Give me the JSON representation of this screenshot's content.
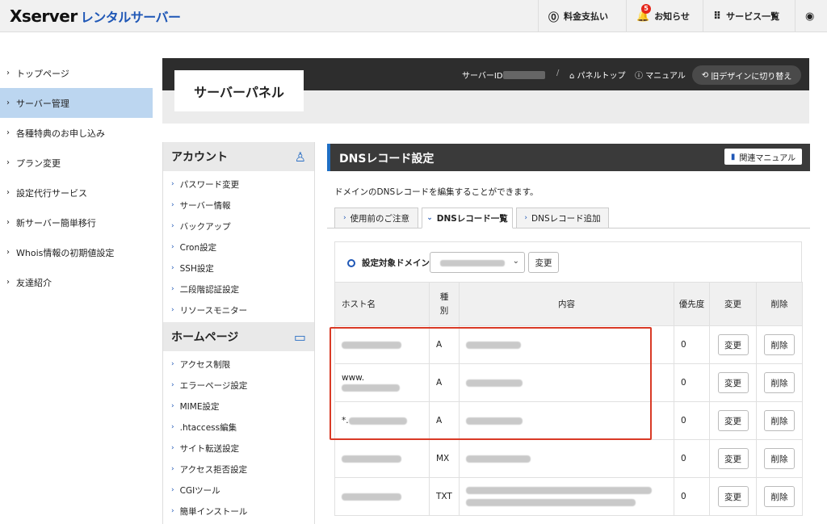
{
  "header": {
    "logo_brand": "Xserver",
    "logo_sub": "レンタルサーバー",
    "billing": "料金支払い",
    "notices": "お知らせ",
    "notice_count": "5",
    "services": "サービス一覧"
  },
  "nav": {
    "items": [
      {
        "label": "トップページ"
      },
      {
        "label": "サーバー管理"
      },
      {
        "label": "各種特典のお申し込み"
      },
      {
        "label": "プラン変更"
      },
      {
        "label": "設定代行サービス"
      },
      {
        "label": "新サーバー簡単移行"
      },
      {
        "label": "Whois情報の初期値設定"
      },
      {
        "label": "友達紹介"
      }
    ]
  },
  "panel": {
    "title": "サーバーパネル",
    "server_id_label": "サーバーID",
    "separator": "/",
    "panel_top": "パネルトップ",
    "manual": "マニュアル",
    "old_design": "旧デザインに切り替え"
  },
  "submenu": {
    "account_title": "アカウント",
    "account_items": [
      "パスワード変更",
      "サーバー情報",
      "バックアップ",
      "Cron設定",
      "SSH設定",
      "二段階認証設定",
      "リソースモニター"
    ],
    "homepage_title": "ホームページ",
    "homepage_items": [
      "アクセス制限",
      "エラーページ設定",
      "MIME設定",
      ".htaccess編集",
      "サイト転送設定",
      "アクセス拒否設定",
      "CGIツール",
      "簡単インストール"
    ]
  },
  "main": {
    "title": "DNSレコード設定",
    "manual_btn": "関連マニュアル",
    "description": "ドメインのDNSレコードを編集することができます。",
    "tabs": [
      {
        "label": "使用前のご注意"
      },
      {
        "label": "DNSレコード一覧"
      },
      {
        "label": "DNSレコード追加"
      }
    ],
    "domain_label": "設定対象ドメイン",
    "domain_change": "変更"
  },
  "table": {
    "headers": {
      "host": "ホスト名",
      "type": "種別",
      "content": "内容",
      "priority": "優先度",
      "edit": "変更",
      "delete": "削除"
    },
    "rows": [
      {
        "host_prefix": "",
        "type": "A",
        "priority": "0",
        "edit": "変更",
        "delete": "削除"
      },
      {
        "host_prefix": "www.",
        "type": "A",
        "priority": "0",
        "edit": "変更",
        "delete": "削除"
      },
      {
        "host_prefix": "*.",
        "type": "A",
        "priority": "0",
        "edit": "変更",
        "delete": "削除"
      },
      {
        "host_prefix": "",
        "type": "MX",
        "priority": "0",
        "edit": "変更",
        "delete": "削除"
      },
      {
        "host_prefix": "",
        "type": "TXT",
        "priority": "0",
        "edit": "変更",
        "delete": "削除"
      }
    ]
  },
  "colors": {
    "accent": "#1f57b6",
    "nav_active": "#bcd6f0",
    "highlight": "#d93a26",
    "dark_bar": "#2d2d2d"
  }
}
